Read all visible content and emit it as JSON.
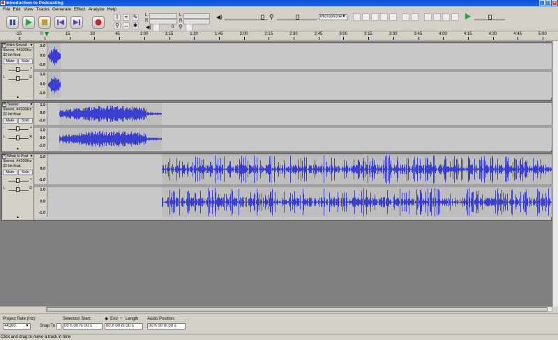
{
  "window": {
    "title": "Introduction to Podcasting"
  },
  "menu": [
    "File",
    "Edit",
    "View",
    "Tracks",
    "Generate",
    "Effect",
    "Analyze",
    "Help"
  ],
  "toolbar": {
    "output_meter_label": "L",
    "meter_r": "R",
    "input_device": "Microphone",
    "meter_zero": "0"
  },
  "ruler": {
    "ticks": [
      "-15",
      "0",
      "15",
      "30",
      "45",
      "1:00",
      "1:15",
      "1:30",
      "1:45",
      "2:00",
      "2:15",
      "2:30",
      "2:45",
      "3:00",
      "3:15",
      "3:30",
      "3:45",
      "4:00",
      "4:15",
      "4:30",
      "4:45",
      "5:00"
    ]
  },
  "tracks": [
    {
      "name": "Intro Sound",
      "info1": "Stereo, 44100Hz",
      "info2": "32-bit float",
      "mute": "Mute",
      "solo": "Solo",
      "scale": [
        "1.0",
        "0.0",
        "-1.0"
      ]
    },
    {
      "name": "Teaser",
      "info1": "Stereo, 44100Hz",
      "info2": "32-bit float",
      "mute": "Mute",
      "solo": "Solo",
      "scale": [
        "1.0",
        "0.0",
        "-1.0"
      ]
    },
    {
      "name": "What Is Pod",
      "info1": "Stereo, 44100Hz",
      "info2": "32-bit float",
      "mute": "Mute",
      "solo": "Solo",
      "scale": [
        "1.0",
        "0.0",
        "-1.0"
      ]
    }
  ],
  "pan": {
    "l": "L",
    "r": "R"
  },
  "collapse_arrow": "▲",
  "selection": {
    "project_rate_label": "Project Rate (Hz):",
    "project_rate": "44100",
    "snap_to_label": "Snap To",
    "selection_start_label": "Selection Start:",
    "end_label": "End",
    "length_label": "Length",
    "audio_position_label": "Audio Position:",
    "start_value": "00 h 00 m 00 s",
    "end_value": "00 h 00 m 00 s",
    "audio_value": "00 h 00 m 00 s"
  },
  "status": "Click and drag to move a track in time",
  "colors": {
    "waveform": "#3a3fcf",
    "clip": "#bdbdbd"
  }
}
